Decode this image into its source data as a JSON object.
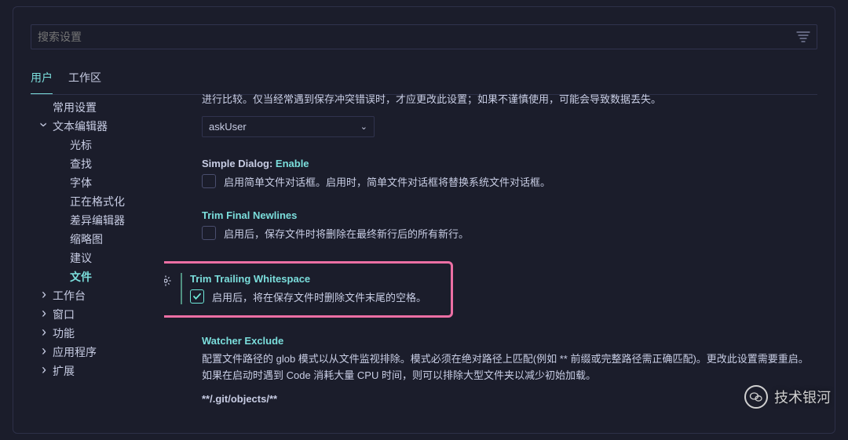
{
  "search": {
    "placeholder": "搜索设置"
  },
  "tabs": {
    "user": "用户",
    "workspace": "工作区"
  },
  "sidebar": {
    "common": "常用设置",
    "textEditor": "文本编辑器",
    "cursor": "光标",
    "find": "查找",
    "font": "字体",
    "formatting": "正在格式化",
    "diffEditor": "差异编辑器",
    "minimap": "缩略图",
    "suggestions": "建议",
    "files": "文件",
    "workbench": "工作台",
    "window": "窗口",
    "features": "功能",
    "application": "应用程序",
    "extensions": "扩展"
  },
  "settings": {
    "conflict": {
      "desc": "进行比较。仅当经常遇到保存冲突错误时，才应更改此设置；如果不谨慎使用，可能会导致数据丢失。",
      "value": "askUser"
    },
    "simpleDialog": {
      "title_grey": "Simple Dialog: ",
      "title_teal": "Enable",
      "label": "启用简单文件对话框。启用时，简单文件对话框将替换系统文件对话框。"
    },
    "trimFinal": {
      "title": "Trim Final Newlines",
      "label": "启用后，保存文件时将删除在最终新行后的所有新行。"
    },
    "trimTrailing": {
      "title": "Trim Trailing Whitespace",
      "label": "启用后，将在保存文件时删除文件末尾的空格。"
    },
    "watcherExclude": {
      "title": "Watcher Exclude",
      "desc": "配置文件路径的 glob 模式以从文件监视排除。模式必须在绝对路径上匹配(例如 ** 前缀或完整路径需正确匹配)。更改此设置需要重启。如果在启动时遇到 Code 消耗大量 CPU 时间，则可以排除大型文件夹以减少初始加载。",
      "code": "**/.git/objects/**"
    }
  },
  "watermark": "技术银河"
}
